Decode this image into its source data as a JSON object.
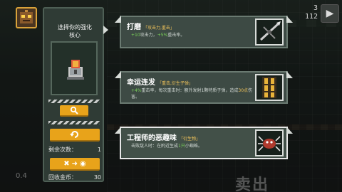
{
  "hud": {
    "top_right_value": "3",
    "top_right_count": "112",
    "pause_icon": "pause-icon"
  },
  "background": {
    "sell_label": "卖出",
    "bottom_left_text": "0.4"
  },
  "left_panel": {
    "title_line1": "选择你的强化",
    "title_line2": "核心",
    "remaining_label": "剩余次数：",
    "remaining_value": "1",
    "recycle_label": "回收金币：",
    "recycle_value": "30"
  },
  "cards": [
    {
      "title": "打磨",
      "tag": "「攻击力,重击」",
      "desc_parts": [
        "+10",
        "攻击力，",
        "+5%",
        "重击率。"
      ],
      "icon": "crossbow-icon"
    },
    {
      "title": "幸运连发",
      "tag": "「重击,衍生子弹」",
      "desc_a": "+4%",
      "desc_b": "重击率，每次重击时：额外发射1颗特质子弹，造成",
      "desc_c": "30点",
      "desc_d": "伤害。",
      "icon": "bullet-belt-icon"
    },
    {
      "title": "工程师的恶趣味",
      "tag": "「衍生物」",
      "desc_a": "击败敌人时：在附近生成",
      "desc_b": "1只",
      "desc_c": "小蜘蛛。",
      "icon": "spider-icon"
    }
  ],
  "colors": {
    "accent": "#e8a31a",
    "panel": "#2f3b35",
    "positive": "#7bd35a",
    "tag": "#f0c35a"
  }
}
